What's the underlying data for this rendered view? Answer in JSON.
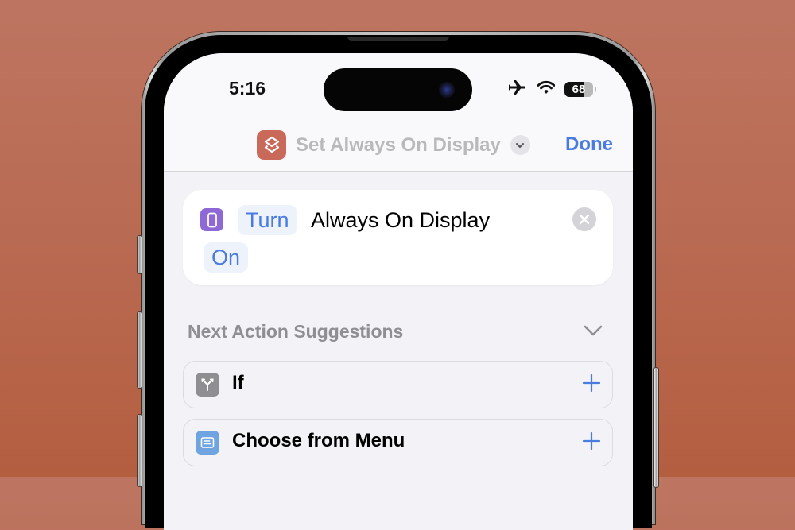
{
  "status_bar": {
    "time": "5:16",
    "battery": "68",
    "icons": [
      "airplane-icon",
      "wifi-icon",
      "battery-icon"
    ]
  },
  "nav": {
    "title": "Set Always On Display",
    "app_icon": "shortcuts-layers-icon",
    "done_label": "Done"
  },
  "action": {
    "icon": "iphone-icon",
    "verb_token": "Turn",
    "text": "Always On Display",
    "state_token": "On"
  },
  "suggestions": {
    "title": "Next Action Suggestions",
    "items": [
      {
        "label": "If",
        "icon": "branch-icon",
        "icon_color": "#8e8e93"
      },
      {
        "label": "Choose from Menu",
        "icon": "menu-icon",
        "icon_color": "#6fa4e0"
      }
    ]
  },
  "colors": {
    "accent": "#4a7bdf",
    "app_icon": "#c8695a",
    "action_icon": "#8e68d4",
    "background": "#b96a52"
  }
}
